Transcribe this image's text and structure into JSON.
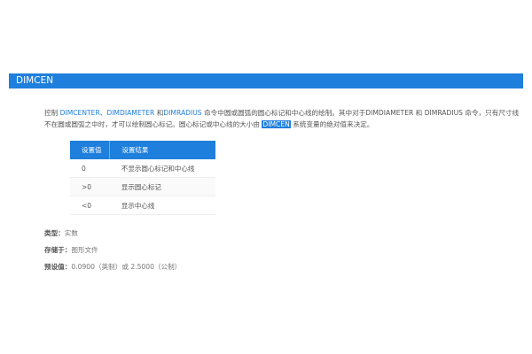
{
  "title": "DIMCEN",
  "para": {
    "p1": "控制 ",
    "l1": "DIMCENTER",
    "s1": "、",
    "l2": "DIMDIAMETER",
    "s2": " 和",
    "l3": "DIMRADIUS",
    "s3": " 命令中圆或圆弧的圆心标记和中心线的绘制。其中对于DIMDIAMETER 和 DIMRADIUS 命令，只有尺寸线不在圆或圆弧之中时，才可以绘制圆心标记。圆心标记或中心线的大小由 ",
    "hl": "DIMCEN",
    "s4": " 系统变量的绝对值来决定。"
  },
  "table": {
    "headers": [
      "设置值",
      "设置结果"
    ],
    "rows": [
      [
        "0",
        "不显示圆心标记和中心线"
      ],
      [
        ">0",
        "显示圆心标记"
      ],
      [
        "<0",
        "显示中心线"
      ]
    ]
  },
  "meta": {
    "type_label": "类型：",
    "type_value": "实数",
    "stored_label": "存储于：",
    "stored_value": "图形文件",
    "default_label": "预设值：",
    "default_value": "0.0900（英制）或 2.5000（公制）"
  }
}
